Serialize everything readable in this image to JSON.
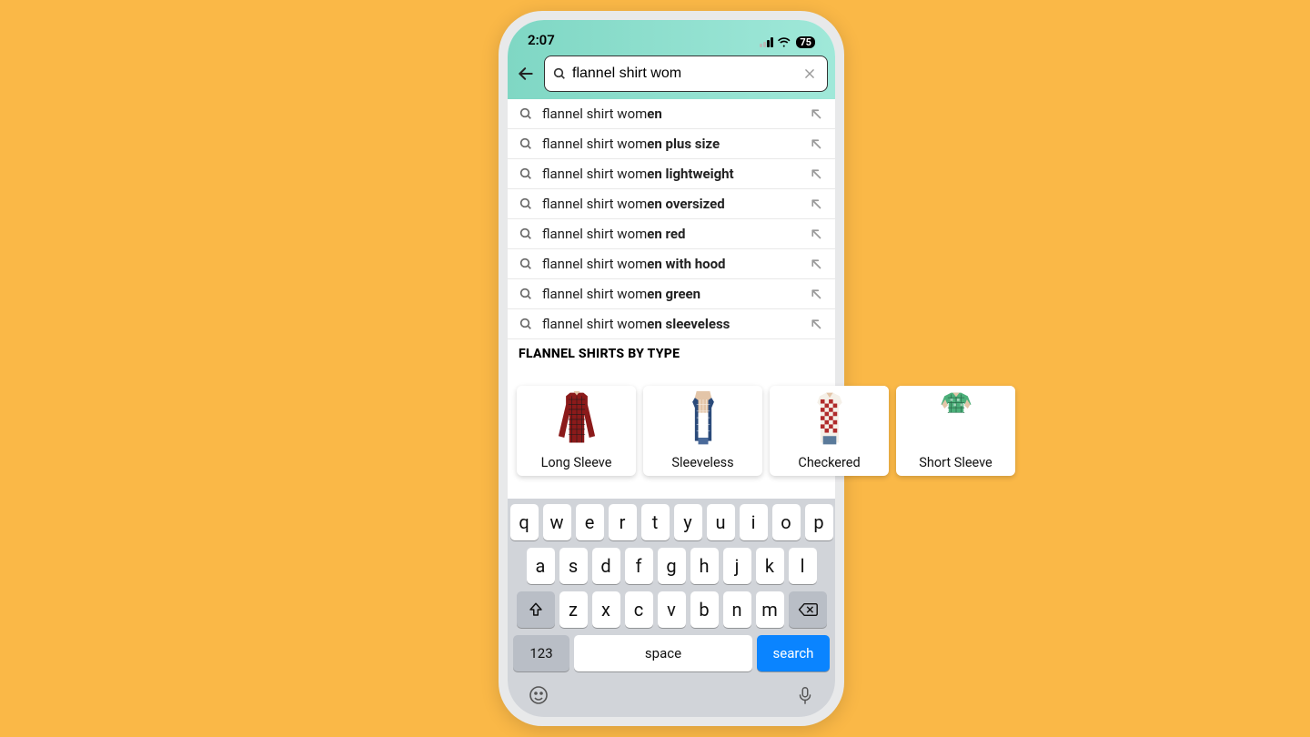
{
  "statusbar": {
    "time": "2:07",
    "battery": "75"
  },
  "search": {
    "value": "flannel shirt wom",
    "placeholder": "Search"
  },
  "suggestions": [
    {
      "prefix": "flannel shirt wom",
      "bold": "en"
    },
    {
      "prefix": "flannel shirt wom",
      "bold": "en plus size"
    },
    {
      "prefix": "flannel shirt wom",
      "bold": "en lightweight"
    },
    {
      "prefix": "flannel shirt wom",
      "bold": "en oversized"
    },
    {
      "prefix": "flannel shirt wom",
      "bold": "en red"
    },
    {
      "prefix": "flannel shirt wom",
      "bold": "en with hood"
    },
    {
      "prefix": "flannel shirt wom",
      "bold": "en green"
    },
    {
      "prefix": "flannel shirt wom",
      "bold": "en sleeveless"
    }
  ],
  "types": {
    "header": "FLANNEL SHIRTS BY TYPE",
    "items": [
      {
        "label": "Long Sleeve"
      },
      {
        "label": "Sleeveless"
      },
      {
        "label": "Checkered"
      },
      {
        "label": "Short Sleeve"
      }
    ]
  },
  "keyboard": {
    "row1": [
      "q",
      "w",
      "e",
      "r",
      "t",
      "y",
      "u",
      "i",
      "o",
      "p"
    ],
    "row2": [
      "a",
      "s",
      "d",
      "f",
      "g",
      "h",
      "j",
      "k",
      "l"
    ],
    "row3": [
      "z",
      "x",
      "c",
      "v",
      "b",
      "n",
      "m"
    ],
    "numKey": "123",
    "spaceKey": "space",
    "searchKey": "search"
  }
}
